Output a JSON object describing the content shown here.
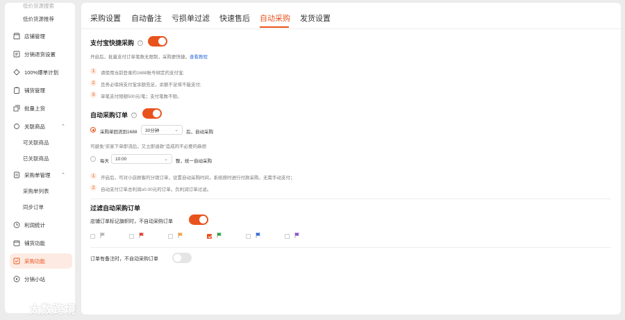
{
  "sidebar": {
    "items": [
      {
        "label": "低价货源搜索",
        "icon": "none"
      },
      {
        "label": "低价货源推荐",
        "icon": "none"
      },
      {
        "label": "店铺管理",
        "icon": "store-icon"
      },
      {
        "label": "分销退货设置",
        "icon": "return-icon"
      },
      {
        "label": "100%爆单计划",
        "icon": "rocket-icon"
      },
      {
        "label": "铺货管理",
        "icon": "clipboard-icon"
      },
      {
        "label": "批量上货",
        "icon": "copy-icon"
      },
      {
        "label": "关联商品",
        "icon": "link-icon"
      },
      {
        "label": "可关联商品",
        "icon": "none"
      },
      {
        "label": "已关联商品",
        "icon": "none"
      },
      {
        "label": "采购单管理",
        "icon": "order-icon"
      },
      {
        "label": "采购单列表",
        "icon": "none"
      },
      {
        "label": "同步订单",
        "icon": "none"
      },
      {
        "label": "利润统计",
        "icon": "chart-icon"
      },
      {
        "label": "铺货功能",
        "icon": "box-icon"
      },
      {
        "label": "采购功能",
        "icon": "purchase-icon"
      },
      {
        "label": "分销小站",
        "icon": "network-icon"
      }
    ],
    "chevron_up": "⌃"
  },
  "tabs": [
    "采购设置",
    "自动备注",
    "亏损单过滤",
    "快速售后",
    "自动采购",
    "发货设置"
  ],
  "alipay": {
    "title": "支付宝快捷采购",
    "help": "?",
    "desc": "开启后，批量支付订单笔数无限制，采购更快捷。",
    "link": "查看教程",
    "notes": [
      "请使用当前登录的1688账号绑定的支付宝;",
      "且务必保持支付宝余额充足，余额不足将不能支付;",
      "单笔支付限额500元/笔；支付笔数不限。"
    ],
    "enabled": true
  },
  "auto_order": {
    "title": "自动采购订单",
    "help": "?",
    "option1_prefix": "采购单回流到1688",
    "option1_select": "30分钟",
    "option1_suffix": "后，自动采购",
    "option1_note": "可避免\"买家下单即流后，又立即退款\"造成的不必要的麻烦",
    "option2_prefix": "每天",
    "option2_select": "10:00",
    "option2_suffix": "整，统一自动采购",
    "notes": [
      "开启后，可对小店顾客的分销订单，设置自动采购时间，系统按时进行付款采购，无需手动支付；",
      "自动支付订单总利润≥0.00元的订单，负利润订单过滤。"
    ],
    "enabled": true
  },
  "filter": {
    "title": "过滤自动采购订单",
    "flag_label": "店铺订单标记旗帜时，不自动采购订单",
    "flag_enabled": true,
    "flags": [
      {
        "color": "#b5b5b5",
        "checked": false
      },
      {
        "color": "#e03c31",
        "checked": false
      },
      {
        "color": "#f3a13c",
        "checked": false
      },
      {
        "color": "#2e9d43",
        "checked": true
      },
      {
        "color": "#2f6ad8",
        "checked": false
      },
      {
        "color": "#8a4fd1",
        "checked": false
      }
    ],
    "remark_label": "订单有备注时，不自动采购订单",
    "remark_enabled": false
  },
  "watermark": "大数跨境",
  "colors": {
    "accent": "#e8531d",
    "link": "#2f6ad8"
  }
}
